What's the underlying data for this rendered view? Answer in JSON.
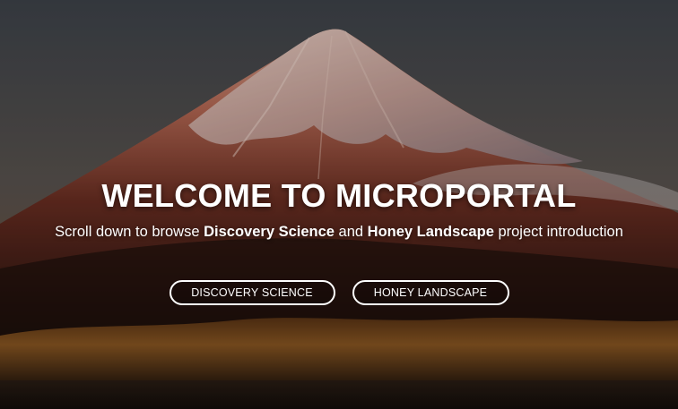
{
  "hero": {
    "title": "WELCOME TO MICROPORTAL",
    "subtitle": {
      "prefix": "Scroll down to browse ",
      "project_a": "Discovery Science",
      "joiner": " and ",
      "project_b": "Honey Landscape",
      "suffix": " project introduction"
    },
    "background": "snow-capped-mountain-at-dusk-photo"
  },
  "buttons": {
    "discovery_label": "DISCOVERY SCIENCE",
    "honey_label": "HONEY LANDSCAPE"
  },
  "colors": {
    "text": "#ffffff",
    "button_border": "#ffffff",
    "sky_top": "#4a4f57",
    "mountain_glow": "#c0674a"
  }
}
